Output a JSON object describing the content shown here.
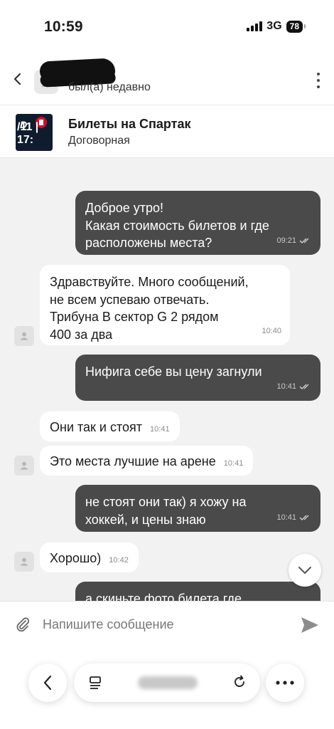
{
  "status_bar": {
    "time": "10:59",
    "network": "3G",
    "battery": "78"
  },
  "header": {
    "user_status": "был(а) недавно"
  },
  "listing": {
    "title": "Билеты на Спартак",
    "price": "Договорная",
    "thumb_text": "/11 | 17:"
  },
  "messages": [
    {
      "dir": "out",
      "lines": [
        "Доброе утро!",
        "Какая стоимость билетов и где",
        "расположены места?"
      ],
      "time": "09:21"
    },
    {
      "dir": "in",
      "lines": [
        "Здравствуйте. Много сообщений,",
        "не всем успеваю отвечать.",
        "Трибуна B сектор G 2 рядом",
        "400 за два"
      ],
      "time": "10:40"
    },
    {
      "dir": "out",
      "lines": [
        "Нифига себе вы цену загнули"
      ],
      "time": "10:41"
    },
    {
      "dir": "in",
      "lines": [
        "Они так и стоят"
      ],
      "time": "10:41"
    },
    {
      "dir": "in",
      "lines": [
        "Это места лучшие на арене"
      ],
      "time": "10:41"
    },
    {
      "dir": "out",
      "lines": [
        "не стоят они так) я хожу на",
        "хоккей, и цены знаю"
      ],
      "time": "10:41"
    },
    {
      "dir": "in",
      "lines": [
        "Хорошо)"
      ],
      "time": "10:42"
    },
    {
      "dir": "out",
      "lines": [
        "а скиньте фото билета где"
      ],
      "time": ""
    }
  ],
  "composer": {
    "placeholder": "Напишите сообщение"
  },
  "colors": {
    "outgoing_bubble": "#4a4a4a",
    "incoming_bubble": "#ffffff",
    "background": "#f2f2f2"
  }
}
